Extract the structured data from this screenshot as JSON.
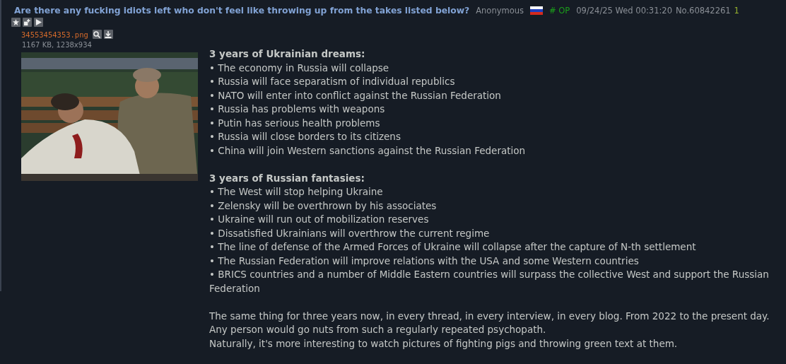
{
  "post": {
    "subject": "Are there any fucking idiots left who don't feel like throwing up from the takes listed below?",
    "name": "Anonymous",
    "tag": "# OP",
    "datetime": "09/24/25 Wed 00:31:20",
    "number": "No.60842261",
    "reply_count": "1"
  },
  "file": {
    "name": "34553454353.png",
    "info": "1167 KB, 1238x934",
    "kind": "picture"
  },
  "body": [
    {
      "kind": "list",
      "heading": "3 years of Ukrainian dreams:",
      "items": [
        "• The economy in Russia will collapse",
        "• Russia will face separatism of individual republics",
        "• NATO will enter into conflict against the Russian Federation",
        "• Russia has problems with weapons",
        "• Putin has serious health problems",
        "• Russia will close borders to its citizens",
        "• China will join Western sanctions against the Russian Federation"
      ]
    },
    {
      "kind": "list",
      "heading": "3 years of Russian fantasies:",
      "items": [
        "• The West will stop helping Ukraine",
        "• Zelensky will be overthrown by his associates",
        "• Ukraine will run out of mobilization reserves",
        "• Dissatisfied Ukrainians will overthrow the current regime",
        "• The line of defense of the Armed Forces of Ukraine will collapse after the capture of N-th settlement",
        "• The Russian Federation will improve relations with the USA and some Western countries",
        "• BRICS countries and a number of Middle Eastern countries will surpass the collective West and support the Russian Federation"
      ]
    },
    {
      "kind": "paragraph",
      "lines": [
        "The same thing for three years now, in every thread, in every interview, in every blog. From 2022 to the present day.",
        "Any person would go nuts from such a regularly repeated psychopath.",
        "Naturally, it's more interesting to watch pictures of fighting pigs and throwing green text at them."
      ]
    }
  ]
}
